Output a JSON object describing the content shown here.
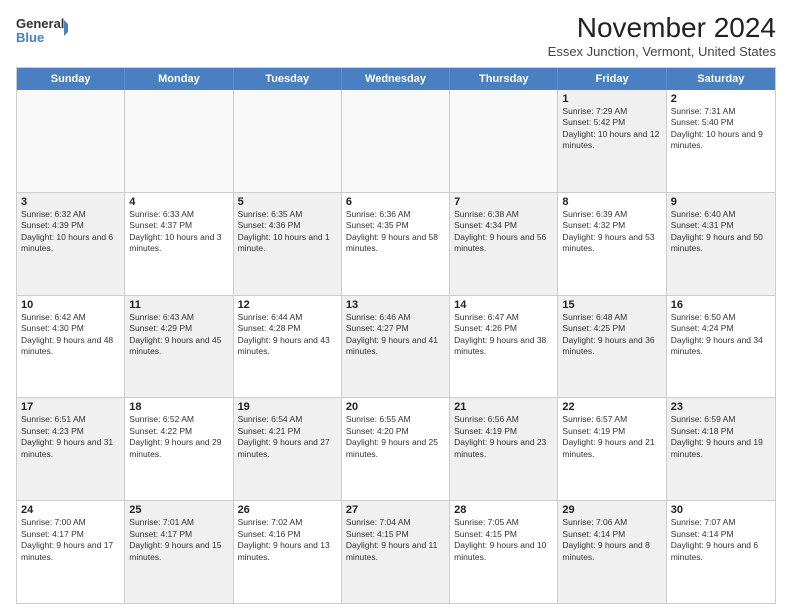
{
  "logo": {
    "line1": "General",
    "line2": "Blue"
  },
  "title": "November 2024",
  "location": "Essex Junction, Vermont, United States",
  "header_days": [
    "Sunday",
    "Monday",
    "Tuesday",
    "Wednesday",
    "Thursday",
    "Friday",
    "Saturday"
  ],
  "rows": [
    [
      {
        "day": "",
        "text": "",
        "empty": true
      },
      {
        "day": "",
        "text": "",
        "empty": true
      },
      {
        "day": "",
        "text": "",
        "empty": true
      },
      {
        "day": "",
        "text": "",
        "empty": true
      },
      {
        "day": "",
        "text": "",
        "empty": true
      },
      {
        "day": "1",
        "text": "Sunrise: 7:29 AM\nSunset: 5:42 PM\nDaylight: 10 hours and 12 minutes.",
        "empty": false,
        "shaded": true
      },
      {
        "day": "2",
        "text": "Sunrise: 7:31 AM\nSunset: 5:40 PM\nDaylight: 10 hours and 9 minutes.",
        "empty": false,
        "shaded": false
      }
    ],
    [
      {
        "day": "3",
        "text": "Sunrise: 6:32 AM\nSunset: 4:39 PM\nDaylight: 10 hours and 6 minutes.",
        "shaded": true
      },
      {
        "day": "4",
        "text": "Sunrise: 6:33 AM\nSunset: 4:37 PM\nDaylight: 10 hours and 3 minutes.",
        "shaded": false
      },
      {
        "day": "5",
        "text": "Sunrise: 6:35 AM\nSunset: 4:36 PM\nDaylight: 10 hours and 1 minute.",
        "shaded": true
      },
      {
        "day": "6",
        "text": "Sunrise: 6:36 AM\nSunset: 4:35 PM\nDaylight: 9 hours and 58 minutes.",
        "shaded": false
      },
      {
        "day": "7",
        "text": "Sunrise: 6:38 AM\nSunset: 4:34 PM\nDaylight: 9 hours and 56 minutes.",
        "shaded": true
      },
      {
        "day": "8",
        "text": "Sunrise: 6:39 AM\nSunset: 4:32 PM\nDaylight: 9 hours and 53 minutes.",
        "shaded": false
      },
      {
        "day": "9",
        "text": "Sunrise: 6:40 AM\nSunset: 4:31 PM\nDaylight: 9 hours and 50 minutes.",
        "shaded": true
      }
    ],
    [
      {
        "day": "10",
        "text": "Sunrise: 6:42 AM\nSunset: 4:30 PM\nDaylight: 9 hours and 48 minutes.",
        "shaded": false
      },
      {
        "day": "11",
        "text": "Sunrise: 6:43 AM\nSunset: 4:29 PM\nDaylight: 9 hours and 45 minutes.",
        "shaded": true
      },
      {
        "day": "12",
        "text": "Sunrise: 6:44 AM\nSunset: 4:28 PM\nDaylight: 9 hours and 43 minutes.",
        "shaded": false
      },
      {
        "day": "13",
        "text": "Sunrise: 6:46 AM\nSunset: 4:27 PM\nDaylight: 9 hours and 41 minutes.",
        "shaded": true
      },
      {
        "day": "14",
        "text": "Sunrise: 6:47 AM\nSunset: 4:26 PM\nDaylight: 9 hours and 38 minutes.",
        "shaded": false
      },
      {
        "day": "15",
        "text": "Sunrise: 6:48 AM\nSunset: 4:25 PM\nDaylight: 9 hours and 36 minutes.",
        "shaded": true
      },
      {
        "day": "16",
        "text": "Sunrise: 6:50 AM\nSunset: 4:24 PM\nDaylight: 9 hours and 34 minutes.",
        "shaded": false
      }
    ],
    [
      {
        "day": "17",
        "text": "Sunrise: 6:51 AM\nSunset: 4:23 PM\nDaylight: 9 hours and 31 minutes.",
        "shaded": true
      },
      {
        "day": "18",
        "text": "Sunrise: 6:52 AM\nSunset: 4:22 PM\nDaylight: 9 hours and 29 minutes.",
        "shaded": false
      },
      {
        "day": "19",
        "text": "Sunrise: 6:54 AM\nSunset: 4:21 PM\nDaylight: 9 hours and 27 minutes.",
        "shaded": true
      },
      {
        "day": "20",
        "text": "Sunrise: 6:55 AM\nSunset: 4:20 PM\nDaylight: 9 hours and 25 minutes.",
        "shaded": false
      },
      {
        "day": "21",
        "text": "Sunrise: 6:56 AM\nSunset: 4:19 PM\nDaylight: 9 hours and 23 minutes.",
        "shaded": true
      },
      {
        "day": "22",
        "text": "Sunrise: 6:57 AM\nSunset: 4:19 PM\nDaylight: 9 hours and 21 minutes.",
        "shaded": false
      },
      {
        "day": "23",
        "text": "Sunrise: 6:59 AM\nSunset: 4:18 PM\nDaylight: 9 hours and 19 minutes.",
        "shaded": true
      }
    ],
    [
      {
        "day": "24",
        "text": "Sunrise: 7:00 AM\nSunset: 4:17 PM\nDaylight: 9 hours and 17 minutes.",
        "shaded": false
      },
      {
        "day": "25",
        "text": "Sunrise: 7:01 AM\nSunset: 4:17 PM\nDaylight: 9 hours and 15 minutes.",
        "shaded": true
      },
      {
        "day": "26",
        "text": "Sunrise: 7:02 AM\nSunset: 4:16 PM\nDaylight: 9 hours and 13 minutes.",
        "shaded": false
      },
      {
        "day": "27",
        "text": "Sunrise: 7:04 AM\nSunset: 4:15 PM\nDaylight: 9 hours and 11 minutes.",
        "shaded": true
      },
      {
        "day": "28",
        "text": "Sunrise: 7:05 AM\nSunset: 4:15 PM\nDaylight: 9 hours and 10 minutes.",
        "shaded": false
      },
      {
        "day": "29",
        "text": "Sunrise: 7:06 AM\nSunset: 4:14 PM\nDaylight: 9 hours and 8 minutes.",
        "shaded": true
      },
      {
        "day": "30",
        "text": "Sunrise: 7:07 AM\nSunset: 4:14 PM\nDaylight: 9 hours and 6 minutes.",
        "shaded": false
      }
    ]
  ]
}
